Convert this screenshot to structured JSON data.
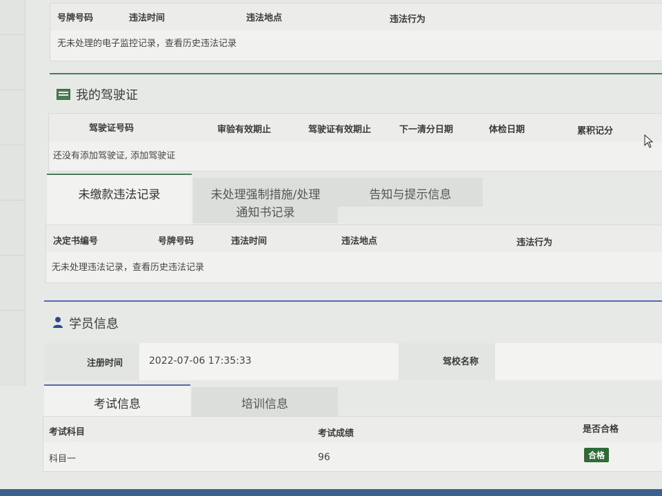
{
  "violation_table": {
    "headers": [
      "号牌号码",
      "违法时间",
      "违法地点",
      "违法行为"
    ],
    "empty_text": "无未处理的电子监控记录，查看历史违法记录"
  },
  "license_panel": {
    "title": "我的驾驶证",
    "headers": [
      "驾驶证号码",
      "审验有效期止",
      "驾驶证有效期止",
      "下一清分日期",
      "体检日期",
      "累积记分"
    ],
    "empty_text": "还没有添加驾驶证, 添加驾驶证"
  },
  "record_tabs": {
    "tabs": [
      "未缴款违法记录",
      "未处理强制措施/处理",
      "通知书记录",
      "告知与提示信息"
    ],
    "headers": [
      "决定书编号",
      "号牌号码",
      "违法时间",
      "违法地点",
      "违法行为"
    ],
    "empty_text": "无未处理违法记录，查看历史违法记录"
  },
  "student_panel": {
    "title": "学员信息",
    "reg_time_label": "注册时间",
    "reg_time_value": "2022-07-06 17:35:33",
    "school_label": "驾校名称",
    "school_value": ""
  },
  "exam_tabs": {
    "tabs": [
      "考试信息",
      "培训信息"
    ],
    "headers": [
      "考试科目",
      "考试成绩",
      "是否合格"
    ],
    "rows": [
      {
        "subject": "科目一",
        "score": "96",
        "passed": "合格"
      }
    ]
  },
  "colors": {
    "green_accent": "#4c7a56",
    "blue_accent": "#5667a8",
    "pass_badge": "#2f6b34"
  }
}
